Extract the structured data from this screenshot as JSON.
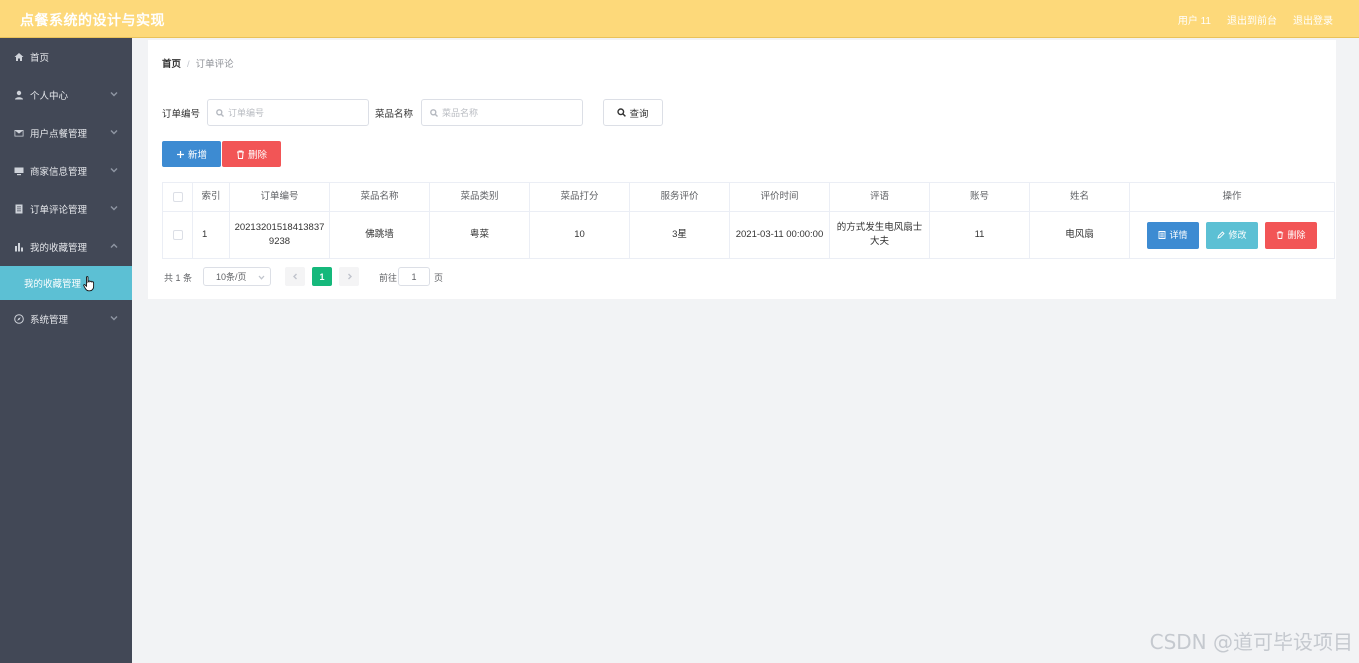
{
  "header": {
    "title": "点餐系统的设计与实现",
    "links": [
      "用户 11",
      "退出到前台",
      "退出登录"
    ]
  },
  "sidebar": {
    "items": [
      {
        "label": "首页",
        "icon": "home-icon"
      },
      {
        "label": "个人中心",
        "icon": "user-icon"
      },
      {
        "label": "用户点餐管理",
        "icon": "mail-icon"
      },
      {
        "label": "商家信息管理",
        "icon": "monitor-icon"
      },
      {
        "label": "订单评论管理",
        "icon": "document-icon"
      },
      {
        "label": "我的收藏管理",
        "icon": "bar-chart-icon"
      },
      {
        "label": "系统管理",
        "icon": "compass-icon"
      }
    ],
    "active_sub": "我的收藏管理"
  },
  "breadcrumb": {
    "home": "首页",
    "sep": "/",
    "current": "订单评论"
  },
  "search": {
    "order_label": "订单编号",
    "order_placeholder": "订单编号",
    "dish_label": "菜品名称",
    "dish_placeholder": "菜品名称",
    "query_label": "查询"
  },
  "actions": {
    "add_label": "新增",
    "delete_label": "删除"
  },
  "table": {
    "headers": [
      "索引",
      "订单编号",
      "菜品名称",
      "菜品类别",
      "菜品打分",
      "服务评价",
      "评价时间",
      "评语",
      "账号",
      "姓名",
      "操作"
    ],
    "rows": [
      {
        "index": "1",
        "order_no": "202132015184138379238",
        "dish_name": "佛跳墙",
        "dish_category": "粤菜",
        "dish_score": "10",
        "service_rating": "3星",
        "review_time": "2021-03-11 00:00:00",
        "comment": "的方式发生电风扇士大夫",
        "account": "11",
        "name": "电风扇"
      }
    ],
    "ops": {
      "detail": "详情",
      "edit": "修改",
      "delete": "删除"
    }
  },
  "pagination": {
    "total": "共 1 条",
    "page_size": "10条/页",
    "current_page": "1",
    "goto_label": "前往",
    "goto_value": "1",
    "goto_unit": "页"
  },
  "watermark": "CSDN @道可毕设项目",
  "colors": {
    "header": "#fdd97a",
    "sidebar": "#424856",
    "active": "#5cc0d4",
    "primary": "#3d8bd2",
    "danger": "#f25556",
    "page_active": "#15b87b"
  }
}
